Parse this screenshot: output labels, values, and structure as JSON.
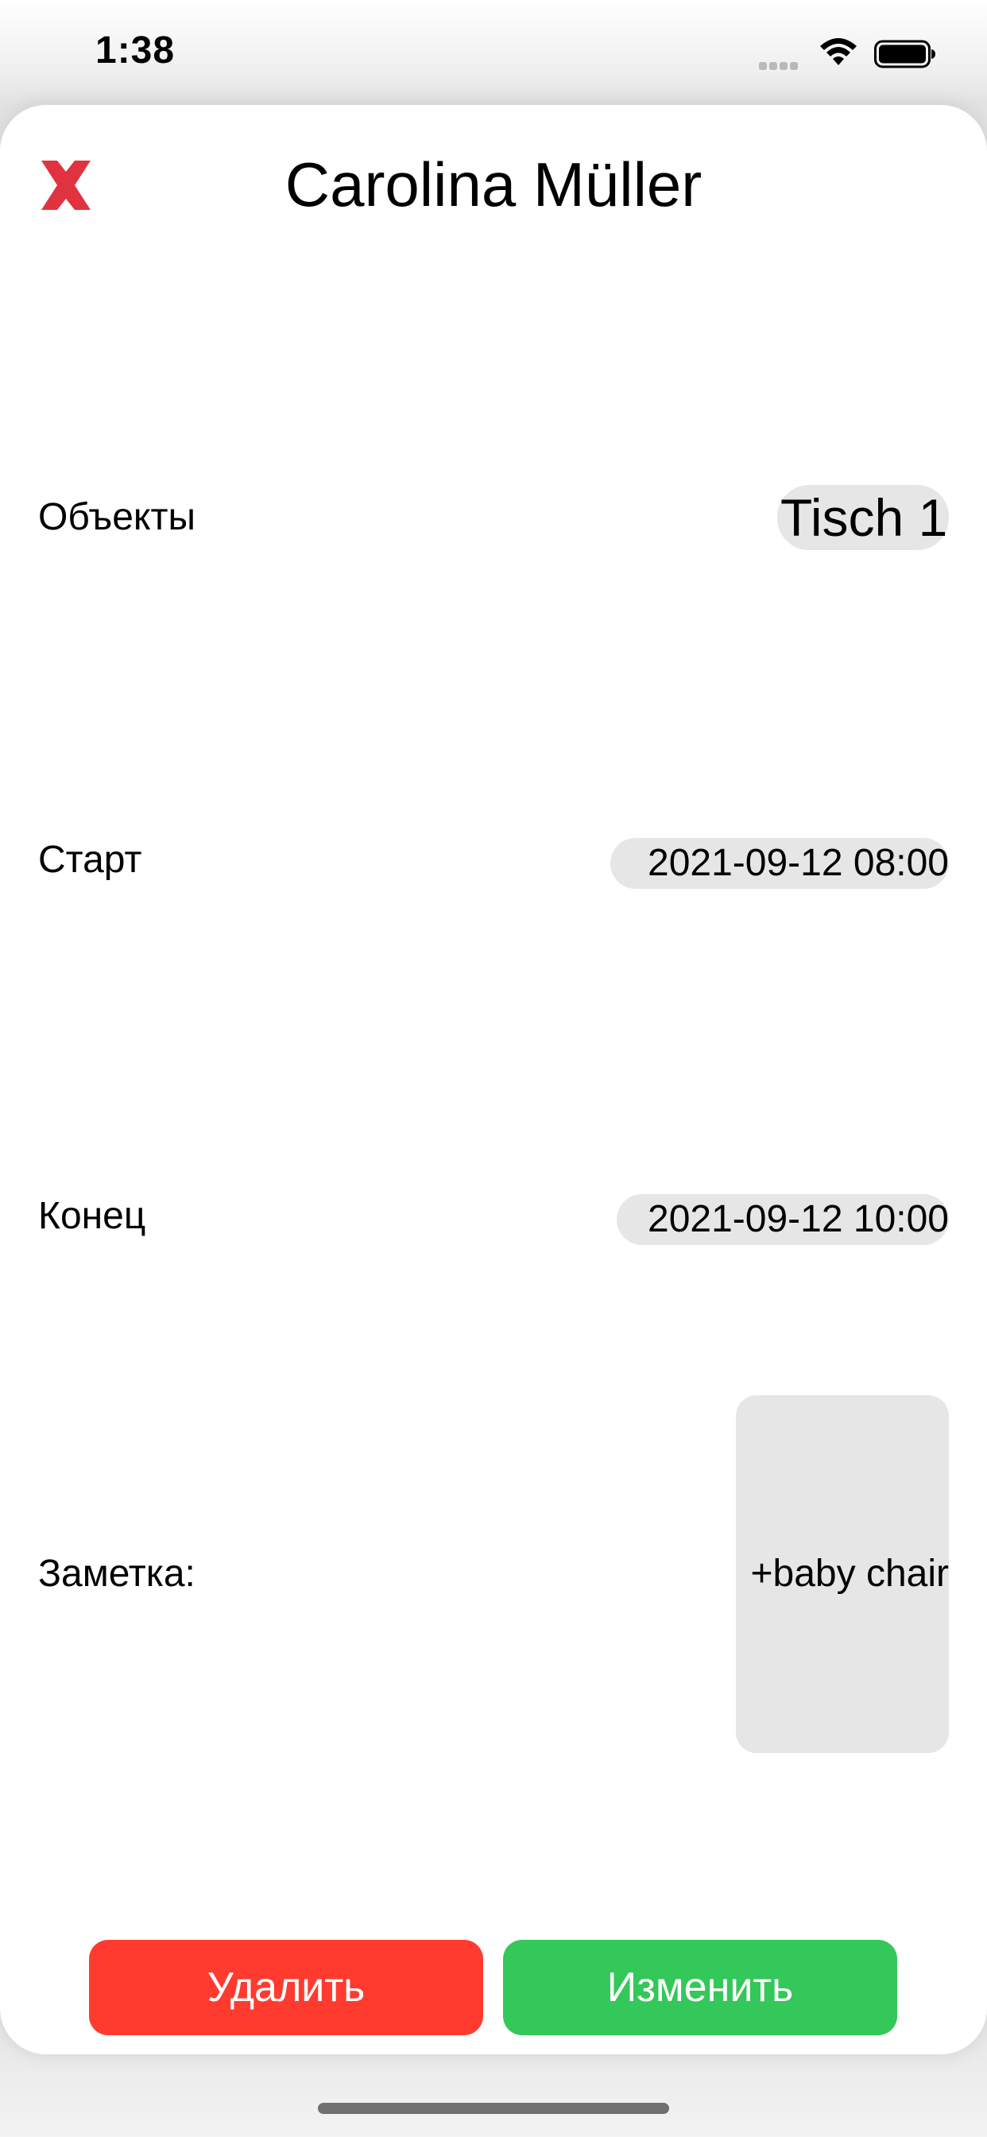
{
  "status_bar": {
    "time": "1:38",
    "signal_icon": "cellular-signal-icon",
    "wifi_icon": "wifi-icon",
    "battery_icon": "battery-icon"
  },
  "header": {
    "close_icon": "close-icon",
    "close_color": "#e0333f",
    "title": "Carolina Müller"
  },
  "fields": {
    "objects": {
      "label": "Объекты",
      "value": "Tisch 1"
    },
    "start": {
      "label": "Старт",
      "value": "2021-09-12 08:00"
    },
    "end": {
      "label": "Конец",
      "value": "2021-09-12 10:00"
    },
    "note": {
      "label": "Заметка:",
      "value": "+baby chair"
    }
  },
  "actions": {
    "delete_label": "Удалить",
    "delete_color": "#ff3b30",
    "edit_label": "Изменить",
    "edit_color": "#34c759"
  },
  "colors": {
    "pill_background": "#e6e6e6",
    "sheet_background": "#ffffff"
  }
}
